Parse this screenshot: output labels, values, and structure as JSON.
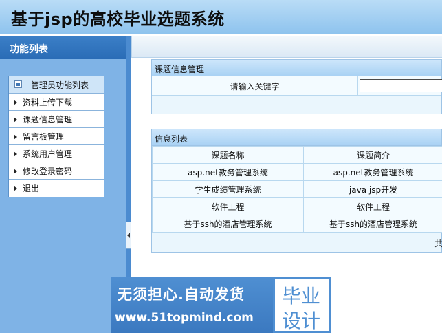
{
  "app": {
    "title": "基于jsp的高校毕业选题系统"
  },
  "sidebar": {
    "header": "功能列表",
    "menu_title": "管理员功能列表",
    "items": [
      {
        "label": "资料上传下载"
      },
      {
        "label": "课题信息管理"
      },
      {
        "label": "留言板管理"
      },
      {
        "label": "系统用户管理"
      },
      {
        "label": "修改登录密码"
      },
      {
        "label": "退出"
      }
    ]
  },
  "search_panel": {
    "title": "课题信息管理",
    "label": "请输入关键字",
    "value": ""
  },
  "list_panel": {
    "title": "信息列表",
    "columns": [
      "课题名称",
      "课题简介"
    ],
    "rows": [
      [
        "asp.net教务管理系统",
        "asp.net教务管理系统"
      ],
      [
        "学生成绩管理系统",
        "java jsp开发"
      ],
      [
        "软件工程",
        "软件工程"
      ],
      [
        "基于ssh的酒店管理系统",
        "基于ssh的酒店管理系统"
      ]
    ],
    "footer": "共"
  },
  "watermark": {
    "slogan": "无须担心.自动发货",
    "url": "www.51topmind.com",
    "brand_line1": "毕业",
    "brand_line2": "设计"
  }
}
